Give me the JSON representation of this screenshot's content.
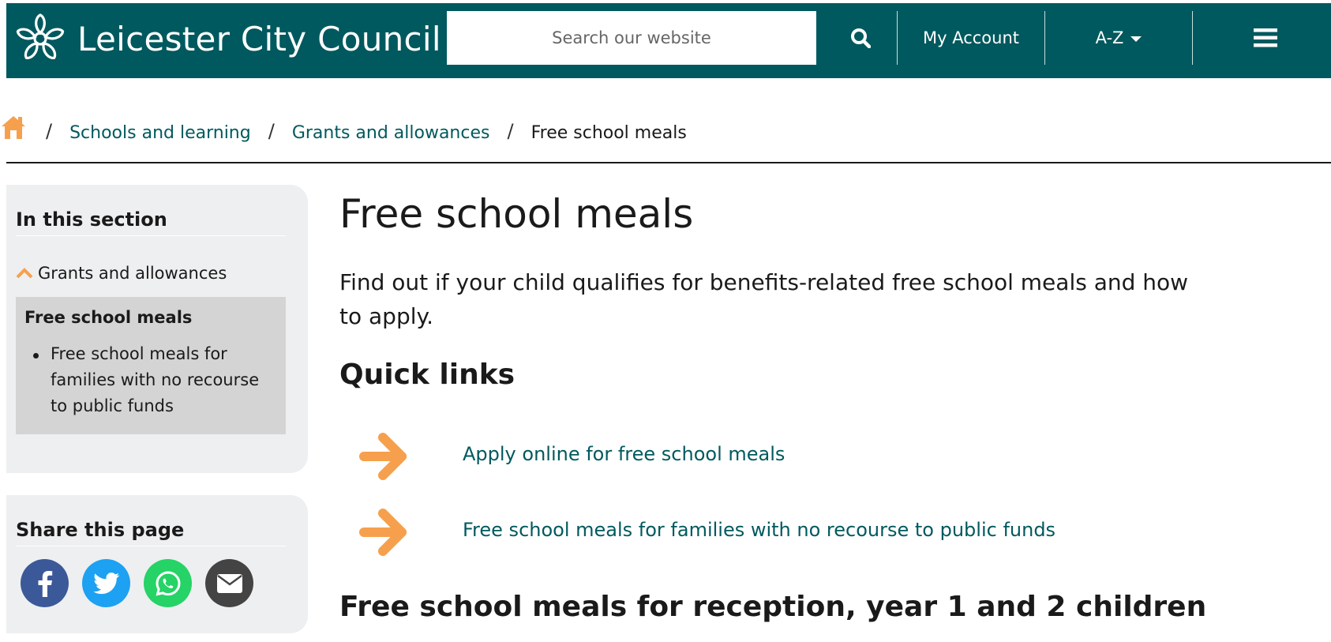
{
  "header": {
    "site_name": "Leicester City Council",
    "search_placeholder": "Search our website",
    "my_account_label": "My Account",
    "az_label": "A-Z",
    "brand_color": "#00595e",
    "icons": [
      "council-flower-logo-icon",
      "search-icon",
      "caret-down-icon",
      "hamburger-menu-icon"
    ]
  },
  "breadcrumb": {
    "home_icon": "home-icon",
    "separator": "/",
    "items": [
      "Schools and learning",
      "Grants and allowances"
    ],
    "current": "Free school meals"
  },
  "sidebar": {
    "section_heading": "In this section",
    "parent_label": "Grants and allowances",
    "active_title": "Free school meals",
    "child_links": [
      "Free school meals for families with no recourse to public funds"
    ],
    "share_heading": "Share this page",
    "share_buttons": [
      {
        "name": "facebook",
        "color": "#3b5998"
      },
      {
        "name": "twitter",
        "color": "#1da1f2"
      },
      {
        "name": "whatsapp",
        "color": "#25d366"
      },
      {
        "name": "email",
        "color": "#444444"
      }
    ]
  },
  "main": {
    "title": "Free school meals",
    "intro": "Find out if your child qualifies for benefits-related free school meals and how to apply.",
    "quick_links_heading": "Quick links",
    "quick_links": [
      "Apply online for free school meals",
      "Free school meals for families with no recourse to public funds"
    ],
    "next_heading": "Free school meals for reception, year 1 and 2 children",
    "accent_color": "#f6a04d"
  }
}
